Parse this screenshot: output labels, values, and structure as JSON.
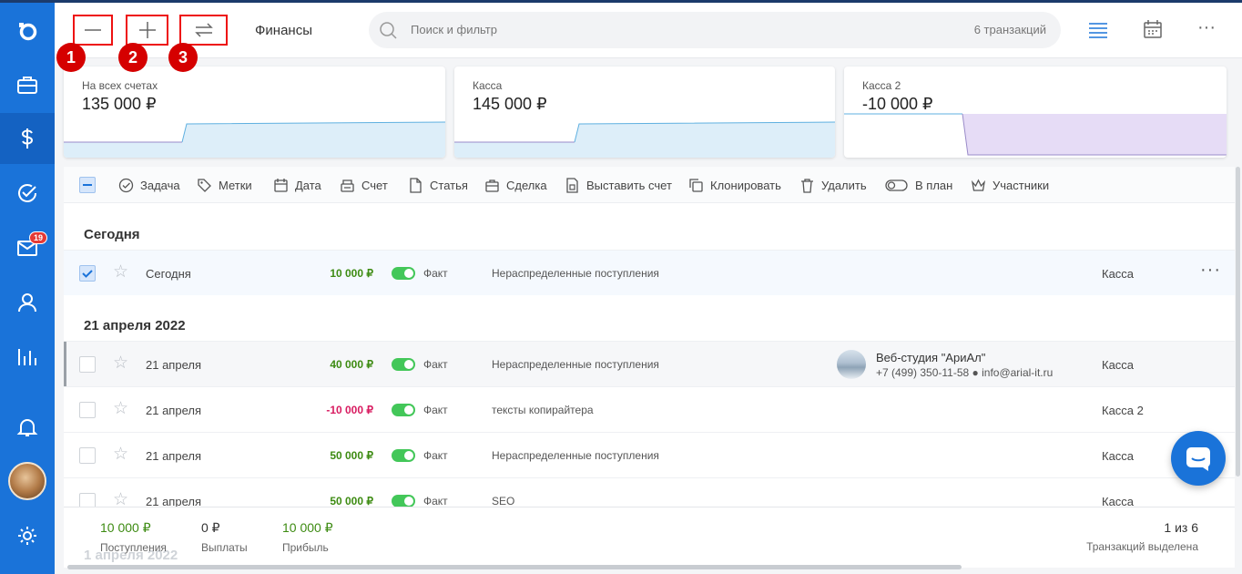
{
  "header": {
    "title": "Финансы",
    "search_placeholder": "Поиск и фильтр",
    "transactions_count": "6 транзакций",
    "buttons": [
      {
        "name": "expense",
        "number": "1"
      },
      {
        "name": "income",
        "number": "2"
      },
      {
        "name": "transfer",
        "number": "3"
      }
    ]
  },
  "sidebar": {
    "mail_badge": "19"
  },
  "accounts": [
    {
      "label": "На всех счетах",
      "value": "135 000 ₽"
    },
    {
      "label": "Касса",
      "value": "145 000 ₽"
    },
    {
      "label": "Касса 2",
      "value": "-10 000 ₽"
    }
  ],
  "toolbar": {
    "task": "Задача",
    "tags": "Метки",
    "date": "Дата",
    "invoice_account": "Счет",
    "article": "Статья",
    "deal": "Сделка",
    "issue_invoice": "Выставить счет",
    "clone": "Клонировать",
    "delete": "Удалить",
    "to_plan": "В план",
    "participants": "Участники"
  },
  "groups": {
    "today": "Сегодня",
    "april": "21 апреля 2022"
  },
  "rows": [
    {
      "date": "Сегодня",
      "amount": "10 000 ₽",
      "status": "Факт",
      "category": "Нераспределенные поступления",
      "account": "Касса",
      "more": "···"
    },
    {
      "date": "21 апреля",
      "amount": "40 000 ₽",
      "status": "Факт",
      "category": "Нераспределенные поступления",
      "account": "Касса",
      "contact_name": "Веб-студия \"АриАл\"",
      "contact_info": "+7 (499) 350-11-58 ● info@arial-it.ru"
    },
    {
      "date": "21 апреля",
      "amount": "-10 000 ₽",
      "status": "Факт",
      "category": "тексты копирайтера",
      "account": "Касса 2"
    },
    {
      "date": "21 апреля",
      "amount": "50 000 ₽",
      "status": "Факт",
      "category": "Нераспределенные поступления",
      "account": "Касса"
    },
    {
      "date": "21 апреля",
      "amount": "50 000 ₽",
      "status": "Факт",
      "category": "SEO",
      "account": "Касса"
    }
  ],
  "footer": {
    "income_value": "10 000 ₽",
    "income_label": "Поступления",
    "payout_value": "0 ₽",
    "payout_label": "Выплаты",
    "profit_value": "10 000 ₽",
    "profit_label": "Прибыль",
    "selected_value": "1 из 6",
    "selected_label": "Транзакций выделена",
    "ghost_group": "1 апреля 2022"
  },
  "colors": {
    "sidebar": "#1a73d9",
    "positive": "#3d8b12",
    "negative": "#d81b60",
    "toggle": "#43c759",
    "highlight": "#d50000"
  }
}
